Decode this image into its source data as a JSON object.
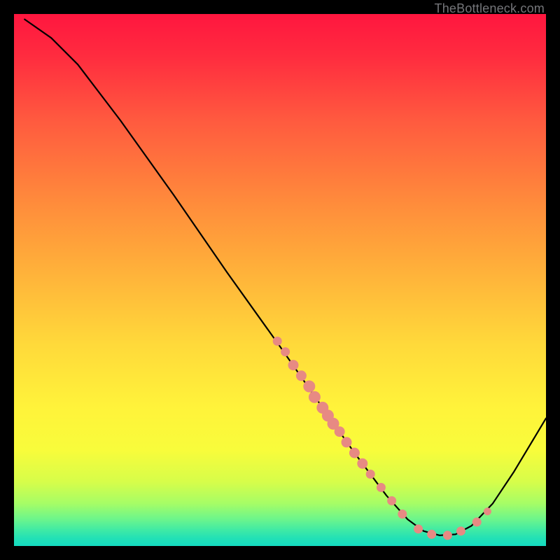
{
  "watermark": "TheBottleneck.com",
  "chart_data": {
    "type": "line",
    "title": "",
    "xlabel": "",
    "ylabel": "",
    "xlim": [
      0,
      100
    ],
    "ylim": [
      0,
      100
    ],
    "curve_points": [
      {
        "x": 2.0,
        "y": 99.0
      },
      {
        "x": 7.0,
        "y": 95.5
      },
      {
        "x": 12.0,
        "y": 90.5
      },
      {
        "x": 20.0,
        "y": 80.0
      },
      {
        "x": 30.0,
        "y": 66.0
      },
      {
        "x": 40.0,
        "y": 51.5
      },
      {
        "x": 50.0,
        "y": 37.5
      },
      {
        "x": 58.0,
        "y": 26.0
      },
      {
        "x": 64.0,
        "y": 17.5
      },
      {
        "x": 70.0,
        "y": 9.5
      },
      {
        "x": 74.0,
        "y": 5.0
      },
      {
        "x": 77.0,
        "y": 2.8
      },
      {
        "x": 80.0,
        "y": 2.0
      },
      {
        "x": 83.0,
        "y": 2.2
      },
      {
        "x": 86.0,
        "y": 3.8
      },
      {
        "x": 90.0,
        "y": 8.0
      },
      {
        "x": 94.0,
        "y": 14.0
      },
      {
        "x": 100.0,
        "y": 24.0
      }
    ],
    "data_points": [
      {
        "x": 49.5,
        "y": 38.5,
        "r": 6
      },
      {
        "x": 51.0,
        "y": 36.5,
        "r": 6
      },
      {
        "x": 52.5,
        "y": 34.0,
        "r": 7
      },
      {
        "x": 54.0,
        "y": 32.0,
        "r": 7
      },
      {
        "x": 55.5,
        "y": 30.0,
        "r": 8
      },
      {
        "x": 56.5,
        "y": 28.0,
        "r": 8
      },
      {
        "x": 58.0,
        "y": 26.0,
        "r": 8
      },
      {
        "x": 59.0,
        "y": 24.5,
        "r": 8
      },
      {
        "x": 60.0,
        "y": 23.0,
        "r": 8
      },
      {
        "x": 61.2,
        "y": 21.5,
        "r": 7
      },
      {
        "x": 62.5,
        "y": 19.5,
        "r": 7
      },
      {
        "x": 64.0,
        "y": 17.5,
        "r": 7
      },
      {
        "x": 65.5,
        "y": 15.5,
        "r": 7
      },
      {
        "x": 67.0,
        "y": 13.5,
        "r": 6
      },
      {
        "x": 69.0,
        "y": 11.0,
        "r": 6
      },
      {
        "x": 71.0,
        "y": 8.5,
        "r": 6
      },
      {
        "x": 73.0,
        "y": 6.0,
        "r": 6
      },
      {
        "x": 76.0,
        "y": 3.2,
        "r": 6
      },
      {
        "x": 78.5,
        "y": 2.2,
        "r": 6
      },
      {
        "x": 81.5,
        "y": 2.0,
        "r": 6
      },
      {
        "x": 84.0,
        "y": 2.8,
        "r": 6
      },
      {
        "x": 87.0,
        "y": 4.5,
        "r": 6
      },
      {
        "x": 89.0,
        "y": 6.5,
        "r": 5
      }
    ]
  }
}
